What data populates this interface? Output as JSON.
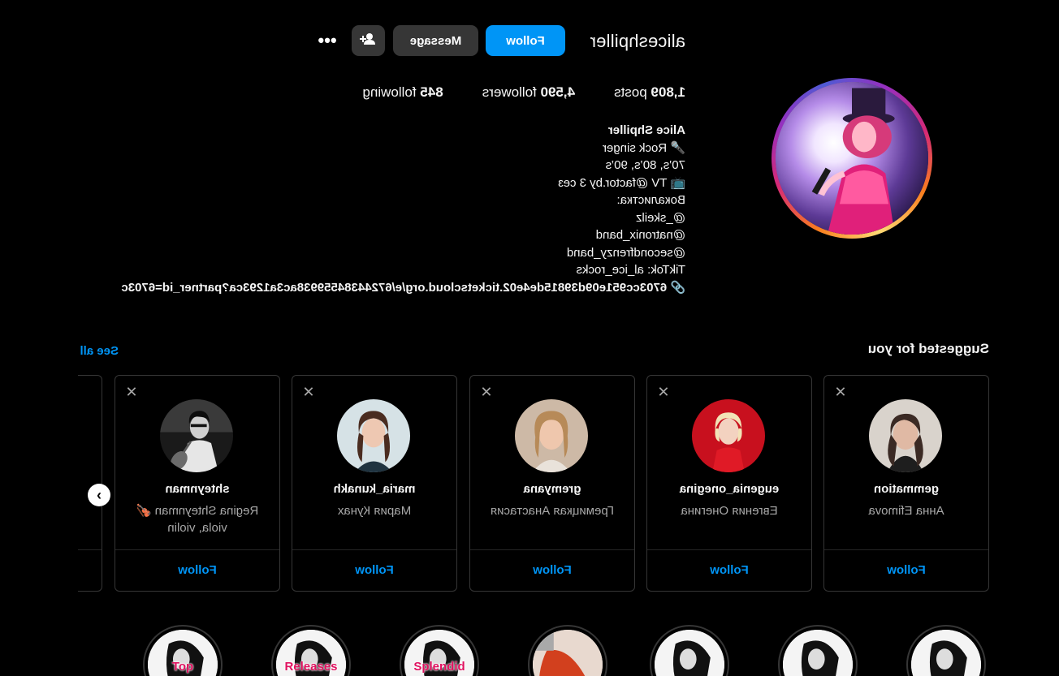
{
  "profile": {
    "username": "aliceshpiller",
    "follow_label": "Follow",
    "message_label": "Message",
    "stats": {
      "posts_count": "1,809",
      "posts_label": "posts",
      "followers_count": "4,590",
      "followers_label": "followers",
      "following_count": "845",
      "following_label": "following"
    },
    "bio": {
      "name": "Alice Shpiller",
      "lines": [
        "🎤 Rock singer",
        "70’s, 80’s, 90’s",
        "📺 TV @factor.by 3 сез",
        "Вокалистка:",
        "@_skeilz",
        "@natronix_band",
        "@secondfrenzy_band",
        "TikTok: al_ice_rocks",
        "🔗 6703cc951e09d39815de4e02.ticketscloud.org/e/67244384559938ac3a1293ca?partner_id=6703c"
      ]
    }
  },
  "suggested": {
    "title": "Suggested for you",
    "see_all": "See all",
    "cards": [
      {
        "username": "gemmation",
        "fullname": "Анна Efimova",
        "follow": "Follow"
      },
      {
        "username": "eugenia_onegina",
        "fullname": "Евгения Онегина",
        "follow": "Follow"
      },
      {
        "username": "gremyana",
        "fullname": "Гремицкая Анастасия",
        "follow": "Follow"
      },
      {
        "username": "maria_kunakh",
        "fullname": "Мария Кунах",
        "follow": "Follow"
      },
      {
        "username": "shteynman",
        "fullname": "Regina Shteynman 🎻 viola, violin",
        "follow": "Follow"
      }
    ]
  },
  "highlights": [
    {
      "label": ""
    },
    {
      "label": ""
    },
    {
      "label": ""
    },
    {
      "label": ""
    },
    {
      "label": "Splendid"
    },
    {
      "label": "Releases"
    },
    {
      "label": "Top"
    }
  ],
  "colors": {
    "accent": "#0095f6",
    "button_secondary": "#363636",
    "background": "#000000",
    "muted_text": "#a8a8a8"
  }
}
